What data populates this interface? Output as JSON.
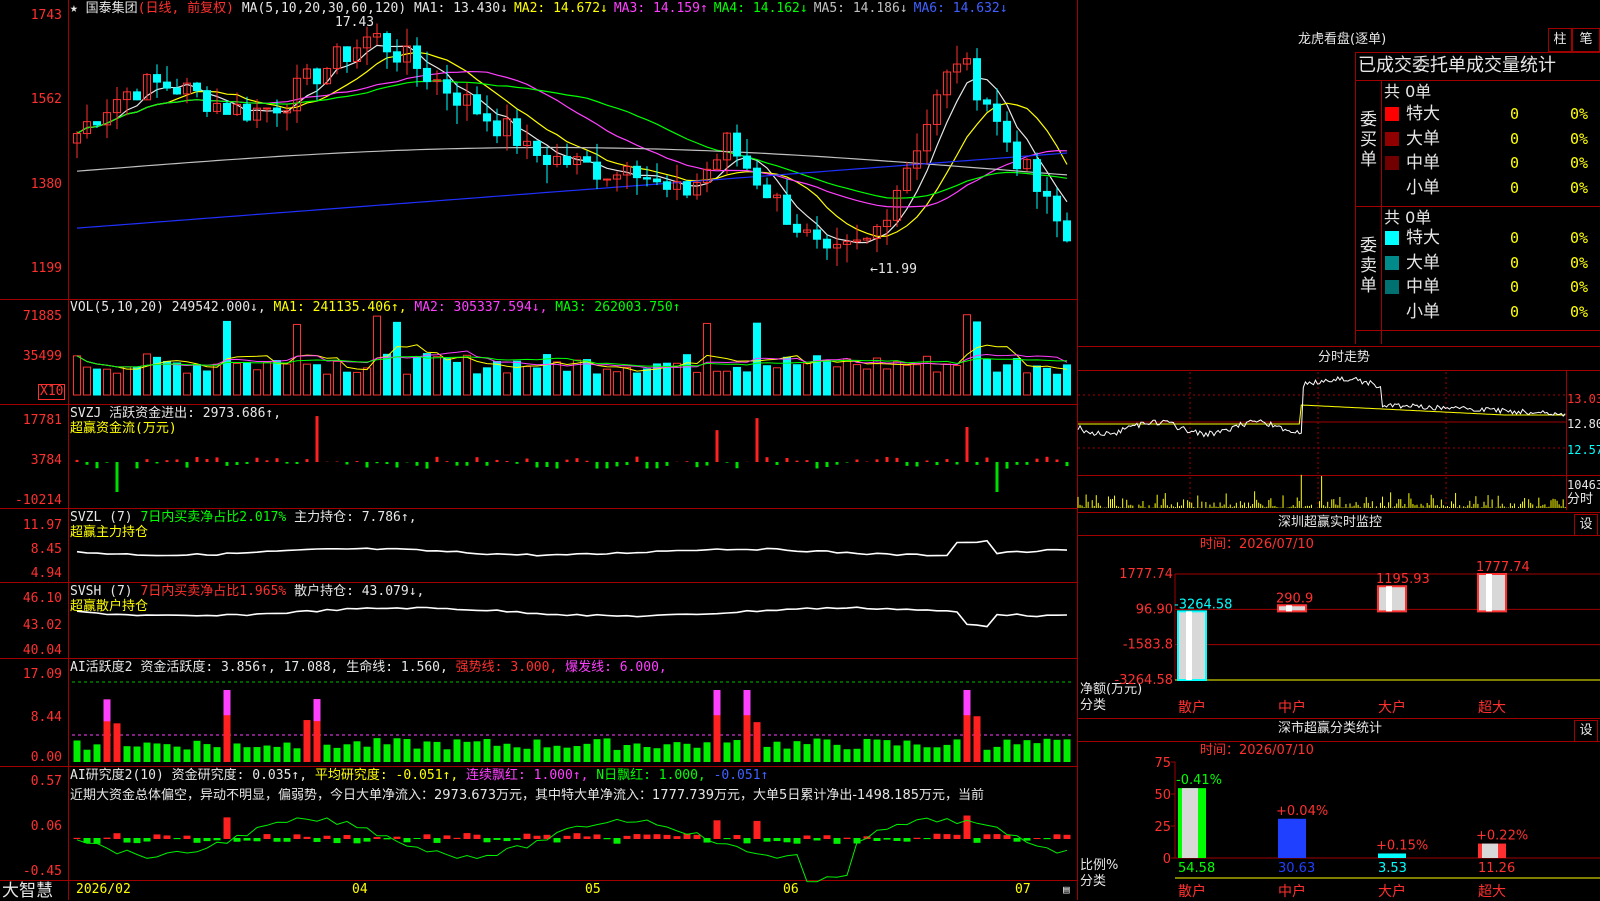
{
  "main": {
    "title_star": "★",
    "stock_name": "国泰集团",
    "mode": "(日线, 前复权)",
    "ma_label": "MA(5,10,20,30,60,120)",
    "ma_values": [
      {
        "name": "MA1:",
        "value": "13.430↓",
        "color": "#e6e6e6"
      },
      {
        "name": "MA2:",
        "value": "14.672↓",
        "color": "#ffff00"
      },
      {
        "name": "MA3:",
        "value": "14.159↑",
        "color": "#ff40ff"
      },
      {
        "name": "MA4:",
        "value": "14.162↓",
        "color": "#00ff00"
      },
      {
        "name": "MA5:",
        "value": "14.186↓",
        "color": "#c0c0c0"
      },
      {
        "name": "MA6:",
        "value": "14.632↓",
        "color": "#4060ff"
      }
    ],
    "y_ticks": [
      "1743",
      "1562",
      "1380",
      "1199"
    ],
    "high_label": "17.43",
    "low_label": "←11.99",
    "x_labels": [
      "2026/02",
      "04",
      "05",
      "06",
      "07"
    ]
  },
  "vol": {
    "label": "VOL(5,10,20)",
    "value": "249542.000↓,",
    "ma1": "MA1: 241135.406↑,",
    "ma2": "MA2: 305337.594↓,",
    "ma3": "MA3: 262003.750↑",
    "y_ticks": [
      "71885",
      "35499"
    ],
    "unit": "X10"
  },
  "svzj": {
    "label": "SVZJ",
    "desc": "活跃资金进出: 2973.686↑,",
    "sub": "超赢资金流(万元)",
    "y_ticks": [
      "17781",
      "3784",
      "-10214"
    ]
  },
  "svzl": {
    "label": "SVZL (7)",
    "desc1": "7日内买卖净占比2.017%",
    "desc2": "主力持仓: 7.786↑,",
    "sub": "超赢主力持仓",
    "y_ticks": [
      "11.97",
      "8.45",
      "4.94"
    ]
  },
  "svsh": {
    "label": "SVSH (7)",
    "desc1": "7日内买卖净占比1.965%",
    "desc2": "散户持仓: 43.079↓,",
    "sub": "超赢散户持仓",
    "y_ticks": [
      "46.10",
      "43.02",
      "40.04"
    ]
  },
  "ai1": {
    "label": "AI活跃度2",
    "desc": "资金活跃度: 3.856↑,",
    "v2": "17.088,",
    "life": "生命线: 1.560,",
    "strong": "强势线: 3.000,",
    "burst": "爆发线: 6.000,",
    "y_ticks": [
      "17.09",
      "8.44",
      "0.00"
    ]
  },
  "ai2": {
    "label": "AI研究度2(10)",
    "desc": "资金研究度: 0.035↑,",
    "avg": "平均研究度: -0.051↑,",
    "red": "连续飘红: 1.000↑,",
    "nred": "N日飘红: 1.000,",
    "last": "-0.051↑",
    "comment": "近期大资金总体偏空，异动不明显，偏弱势，今日大单净流入：2973.673万元，其中特大单净流入：1777.739万元，大单5日累计净出-1498.185万元，当前",
    "y_ticks": [
      "0.57",
      "0.06",
      "-0.45"
    ]
  },
  "footer": {
    "brand": "大智慧"
  },
  "lhb": {
    "title": "龙虎看盘(逐单)",
    "btn1": "柱",
    "btn2": "笔",
    "header": "已成交委托单成交量统计",
    "buy_label": "委买单",
    "sell_label": "委卖单",
    "buy_total": "共 0单",
    "sell_total": "共 0单",
    "buy_rows": [
      {
        "name": "特大",
        "count": "0",
        "pct": "0%",
        "color": "#ff0000"
      },
      {
        "name": "大单",
        "count": "0",
        "pct": "0%",
        "color": "#900000"
      },
      {
        "name": "中单",
        "count": "0",
        "pct": "0%",
        "color": "#700000"
      },
      {
        "name": "小单",
        "count": "0",
        "pct": "0%",
        "color": ""
      }
    ],
    "sell_rows": [
      {
        "name": "特大",
        "count": "0",
        "pct": "0%",
        "color": "#00ffff"
      },
      {
        "name": "大单",
        "count": "0",
        "pct": "0%",
        "color": "#008a8a"
      },
      {
        "name": "中单",
        "count": "0",
        "pct": "0%",
        "color": "#007070"
      },
      {
        "name": "小单",
        "count": "0",
        "pct": "0%",
        "color": ""
      }
    ]
  },
  "intraday": {
    "title": "分时走势",
    "y_ticks": [
      "13.03",
      "12.80",
      "12.57"
    ],
    "vol_label": "10463",
    "x_label": "分时"
  },
  "monitor": {
    "title": "深圳超赢实时监控",
    "btn": "设",
    "time": "时间：2026/07/10",
    "y_ticks": [
      "1777.74",
      "96.90",
      "-1583.8",
      "-3264.58"
    ],
    "unit": "净额(万元)",
    "cat_label": "分类",
    "bars": [
      {
        "cat": "散户",
        "value": -3264.58,
        "label": "-3264.58"
      },
      {
        "cat": "中户",
        "value": 290.9,
        "label": "290.9"
      },
      {
        "cat": "大户",
        "value": 1195.93,
        "label": "1195.93"
      },
      {
        "cat": "超大",
        "value": 1777.74,
        "label": "1777.74"
      }
    ]
  },
  "classify": {
    "title": "深市超赢分类统计",
    "btn": "设",
    "time": "时间：2026/07/10",
    "y_ticks": [
      "75",
      "50",
      "25",
      "0"
    ],
    "unit": "比例%",
    "cat_label": "分类",
    "bars": [
      {
        "cat": "散户",
        "value": 54.58,
        "label": "54.58",
        "change": "-0.41%",
        "color": "#00ff00"
      },
      {
        "cat": "中户",
        "value": 30.63,
        "label": "30.63",
        "change": "+0.04%",
        "color": "#2040ff"
      },
      {
        "cat": "大户",
        "value": 3.53,
        "label": "3.53",
        "change": "+0.15%",
        "color": "#00ffff"
      },
      {
        "cat": "超大",
        "value": 11.26,
        "label": "11.26",
        "change": "+0.22%",
        "color": "#ff3030"
      }
    ]
  }
}
